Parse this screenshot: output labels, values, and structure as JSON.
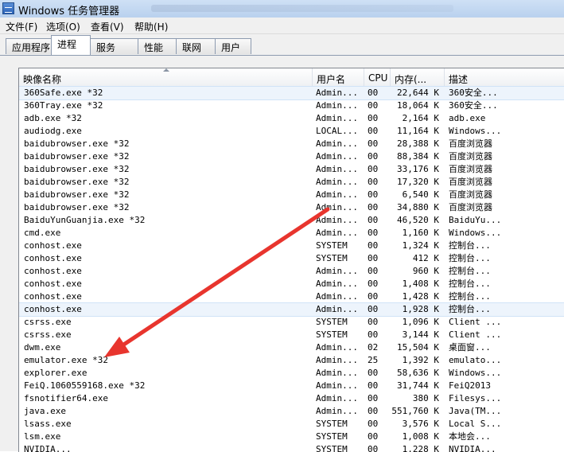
{
  "window": {
    "title": "Windows 任务管理器"
  },
  "menu": [
    "文件(F)",
    "选项(O)",
    "查看(V)",
    "帮助(H)"
  ],
  "tabs": [
    "应用程序",
    "进程",
    "服务",
    "性能",
    "联网",
    "用户"
  ],
  "active_tab": "进程",
  "columns": [
    "映像名称",
    "用户名",
    "CPU",
    "内存(...",
    "描述"
  ],
  "processes": [
    {
      "name": "360Safe.exe *32",
      "user": "Admin...",
      "cpu": "00",
      "mem": "22,644 K",
      "desc": "360安全..."
    },
    {
      "name": "360Tray.exe *32",
      "user": "Admin...",
      "cpu": "00",
      "mem": "18,064 K",
      "desc": "360安全..."
    },
    {
      "name": "adb.exe *32",
      "user": "Admin...",
      "cpu": "00",
      "mem": "2,164 K",
      "desc": "adb.exe"
    },
    {
      "name": "audiodg.exe",
      "user": "LOCAL...",
      "cpu": "00",
      "mem": "11,164 K",
      "desc": "Windows..."
    },
    {
      "name": "baidubrowser.exe *32",
      "user": "Admin...",
      "cpu": "00",
      "mem": "28,388 K",
      "desc": "百度浏览器"
    },
    {
      "name": "baidubrowser.exe *32",
      "user": "Admin...",
      "cpu": "00",
      "mem": "88,384 K",
      "desc": "百度浏览器"
    },
    {
      "name": "baidubrowser.exe *32",
      "user": "Admin...",
      "cpu": "00",
      "mem": "33,176 K",
      "desc": "百度浏览器"
    },
    {
      "name": "baidubrowser.exe *32",
      "user": "Admin...",
      "cpu": "00",
      "mem": "17,320 K",
      "desc": "百度浏览器"
    },
    {
      "name": "baidubrowser.exe *32",
      "user": "Admin...",
      "cpu": "00",
      "mem": "6,540 K",
      "desc": "百度浏览器"
    },
    {
      "name": "baidubrowser.exe *32",
      "user": "Admin...",
      "cpu": "00",
      "mem": "34,880 K",
      "desc": "百度浏览器"
    },
    {
      "name": "BaiduYunGuanjia.exe *32",
      "user": "Admin...",
      "cpu": "00",
      "mem": "46,520 K",
      "desc": "BaiduYu..."
    },
    {
      "name": "cmd.exe",
      "user": "Admin...",
      "cpu": "00",
      "mem": "1,160 K",
      "desc": "Windows..."
    },
    {
      "name": "conhost.exe",
      "user": "SYSTEM",
      "cpu": "00",
      "mem": "1,324 K",
      "desc": "控制台..."
    },
    {
      "name": "conhost.exe",
      "user": "SYSTEM",
      "cpu": "00",
      "mem": "412 K",
      "desc": "控制台..."
    },
    {
      "name": "conhost.exe",
      "user": "Admin...",
      "cpu": "00",
      "mem": "960 K",
      "desc": "控制台..."
    },
    {
      "name": "conhost.exe",
      "user": "Admin...",
      "cpu": "00",
      "mem": "1,408 K",
      "desc": "控制台..."
    },
    {
      "name": "conhost.exe",
      "user": "Admin...",
      "cpu": "00",
      "mem": "1,428 K",
      "desc": "控制台..."
    },
    {
      "name": "conhost.exe",
      "user": "Admin...",
      "cpu": "00",
      "mem": "1,928 K",
      "desc": "控制台..."
    },
    {
      "name": "csrss.exe",
      "user": "SYSTEM",
      "cpu": "00",
      "mem": "1,096 K",
      "desc": "Client ..."
    },
    {
      "name": "csrss.exe",
      "user": "SYSTEM",
      "cpu": "00",
      "mem": "3,144 K",
      "desc": "Client ..."
    },
    {
      "name": "dwm.exe",
      "user": "Admin...",
      "cpu": "02",
      "mem": "15,504 K",
      "desc": "桌面窗..."
    },
    {
      "name": "emulator.exe *32",
      "user": "Admin...",
      "cpu": "25",
      "mem": "1,392 K",
      "desc": "emulato..."
    },
    {
      "name": "explorer.exe",
      "user": "Admin...",
      "cpu": "00",
      "mem": "58,636 K",
      "desc": "Windows..."
    },
    {
      "name": "FeiQ.1060559168.exe *32",
      "user": "Admin...",
      "cpu": "00",
      "mem": "31,744 K",
      "desc": "FeiQ2013"
    },
    {
      "name": "fsnotifier64.exe",
      "user": "Admin...",
      "cpu": "00",
      "mem": "380 K",
      "desc": "Filesys..."
    },
    {
      "name": "java.exe",
      "user": "Admin...",
      "cpu": "00",
      "mem": "551,760 K",
      "desc": "Java(TM..."
    },
    {
      "name": "lsass.exe",
      "user": "SYSTEM",
      "cpu": "00",
      "mem": "3,576 K",
      "desc": "Local S..."
    },
    {
      "name": "lsm.exe",
      "user": "SYSTEM",
      "cpu": "00",
      "mem": "1,008 K",
      "desc": "本地会..."
    },
    {
      "name": "NVIDIA...",
      "user": "SYSTEM",
      "cpu": "00",
      "mem": "1,228 K",
      "desc": "NVIDIA..."
    }
  ],
  "selected_rows": [
    0,
    17
  ],
  "annotation_color": "#e8352e"
}
